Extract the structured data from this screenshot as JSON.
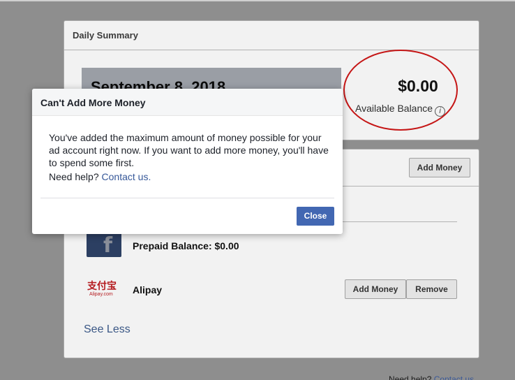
{
  "summary": {
    "title": "Daily Summary",
    "date": "September 8, 2018",
    "balance": "$0.00",
    "balance_label": "Available Balance",
    "info_glyph": "i"
  },
  "payments": {
    "add_money_label": "Add Money",
    "prepaid_label": "Prepaid Balance: $0.00",
    "fb_glyph": "f",
    "alipay_logo_cn": "支付宝",
    "alipay_logo_url": "Alipay.com",
    "alipay_label": "Alipay",
    "alipay_add_label": "Add Money",
    "remove_label": "Remove",
    "see_less": "See Less"
  },
  "footer": {
    "need_help": "Need help?",
    "contact": "Contact us"
  },
  "dialog": {
    "title": "Can't Add More Money",
    "body": "You've added the maximum amount of money possible for your ad account right now. If you want to add more money, you'll have to spend some first.",
    "help_prefix": "Need help?",
    "help_link": "Contact us.",
    "close_label": "Close"
  },
  "colors": {
    "overlay": "#8e8e8e",
    "primary_button": "#4267b2",
    "annotation_ring": "#c51616",
    "link": "#365899"
  }
}
